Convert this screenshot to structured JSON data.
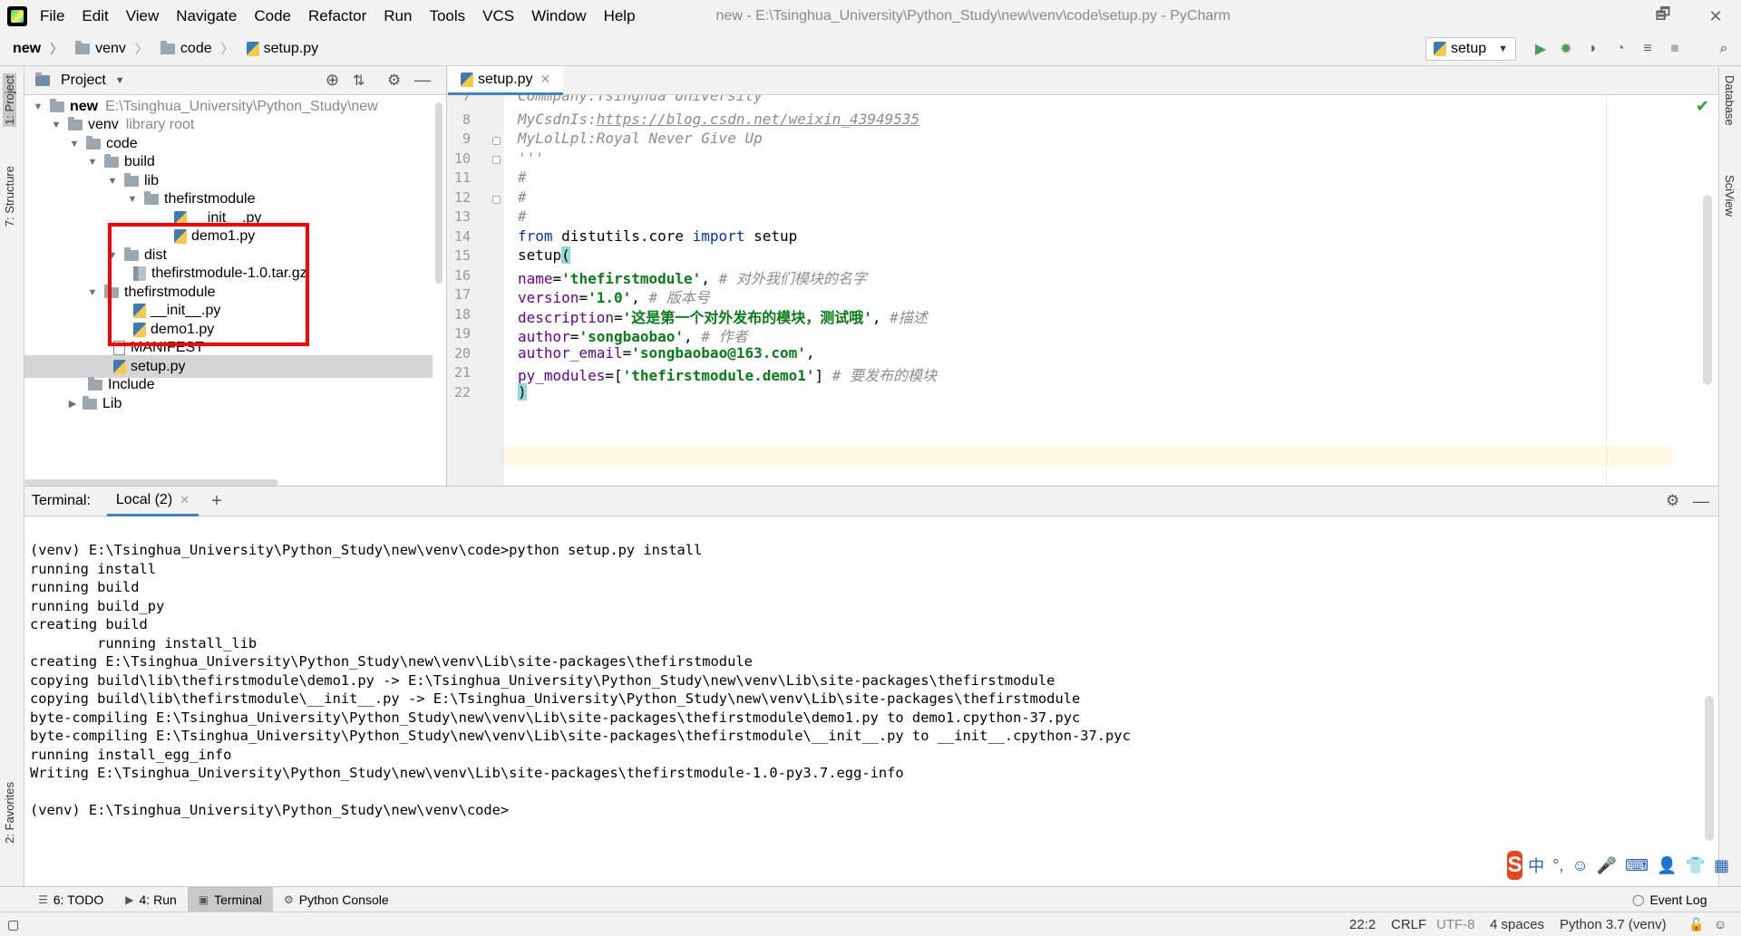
{
  "window": {
    "title": "new - E:\\Tsinghua_University\\Python_Study\\new\\venv\\code\\setup.py - PyCharm",
    "minimize": "🗕",
    "restore": "🗗",
    "close": "✕"
  },
  "menu": [
    "File",
    "Edit",
    "View",
    "Navigate",
    "Code",
    "Refactor",
    "Run",
    "Tools",
    "VCS",
    "Window",
    "Help"
  ],
  "breadcrumb": [
    "new",
    "venv",
    "code",
    "setup.py"
  ],
  "run_config": {
    "label": "setup"
  },
  "left_strip": {
    "project": "1: Project",
    "structure": "7: Structure",
    "favorites": "2: Favorites"
  },
  "right_strip": {
    "database": "Database",
    "sciview": "SciView"
  },
  "project_panel": {
    "title": "Project",
    "tree": [
      {
        "label": "new",
        "hint": "E:\\Tsinghua_University\\Python_Study\\new",
        "bold": true
      },
      {
        "label": "venv",
        "hint": "library root"
      },
      {
        "label": "code"
      },
      {
        "label": "build"
      },
      {
        "label": "lib"
      },
      {
        "label": "thefirstmodule"
      },
      {
        "label": "__init__.py"
      },
      {
        "label": "demo1.py"
      },
      {
        "label": "dist"
      },
      {
        "label": "thefirstmodule-1.0.tar.gz"
      },
      {
        "label": "thefirstmodule"
      },
      {
        "label": "__init__.py"
      },
      {
        "label": "demo1.py"
      },
      {
        "label": "MANIFEST"
      },
      {
        "label": "setup.py",
        "selected": true
      },
      {
        "label": "Include"
      },
      {
        "label": "Lib"
      }
    ]
  },
  "editor": {
    "tab": "setup.py",
    "line_numbers": [
      "7",
      "8",
      "9",
      "10",
      "11",
      "12",
      "13",
      "14",
      "15",
      "16",
      "17",
      "18",
      "19",
      "20",
      "21",
      "22"
    ],
    "code": {
      "l7": "Commpany:Tsinghua University",
      "l8_prefix": "MyCsdnIs:",
      "l8_link": "https://blog.csdn.net/weixin_43949535",
      "l9": "MyLolLpl:Royal Never Give Up",
      "l10": "'''",
      "l11": "#",
      "l12": "#",
      "l13": "#",
      "l14_from": "from",
      "l14_mod": " distutils.core ",
      "l14_import": "import",
      "l14_name": " setup",
      "l15_call": "setup",
      "l15_paren": "(",
      "l16_param": "name",
      "l16_eq": "=",
      "l16_val": "'thefirstmodule'",
      "l16_sep": ", ",
      "l16_cmt": "# 对外我们模块的名字",
      "l17_param": "version",
      "l17_eq": "=",
      "l17_val": "'1.0'",
      "l17_sep": ", ",
      "l17_cmt": "# 版本号",
      "l18_param": "description",
      "l18_eq": "=",
      "l18_val": "'这是第一个对外发布的模块，测试哦'",
      "l18_sep": ", ",
      "l18_cmt": "#描述",
      "l19_param": "author",
      "l19_eq": "=",
      "l19_val": "'songbaobao'",
      "l19_sep": ", ",
      "l19_cmt": "# 作者",
      "l20_param": "author_email",
      "l20_eq": "=",
      "l20_val": "'songbaobao@163.com'",
      "l20_sep": ",",
      "l21_param": "py_modules",
      "l21_eq": "=[",
      "l21_val": "'thefirstmodule.demo1'",
      "l21_close": "] ",
      "l21_cmt": "# 要发布的模块",
      "l22": ")"
    }
  },
  "terminal": {
    "label": "Terminal:",
    "tab": "Local (2)",
    "add": "+",
    "lines": [
      "(venv) E:\\Tsinghua_University\\Python_Study\\new\\venv\\code>python setup.py install",
      "running install",
      "running build",
      "running build_py",
      "creating build",
      "        running install_lib",
      "creating E:\\Tsinghua_University\\Python_Study\\new\\venv\\Lib\\site-packages\\thefirstmodule",
      "copying build\\lib\\thefirstmodule\\demo1.py -> E:\\Tsinghua_University\\Python_Study\\new\\venv\\Lib\\site-packages\\thefirstmodule",
      "copying build\\lib\\thefirstmodule\\__init__.py -> E:\\Tsinghua_University\\Python_Study\\new\\venv\\Lib\\site-packages\\thefirstmodule",
      "byte-compiling E:\\Tsinghua_University\\Python_Study\\new\\venv\\Lib\\site-packages\\thefirstmodule\\demo1.py to demo1.cpython-37.pyc",
      "byte-compiling E:\\Tsinghua_University\\Python_Study\\new\\venv\\Lib\\site-packages\\thefirstmodule\\__init__.py to __init__.cpython-37.pyc",
      "running install_egg_info",
      "Writing E:\\Tsinghua_University\\Python_Study\\new\\venv\\Lib\\site-packages\\thefirstmodule-1.0-py3.7.egg-info",
      "",
      "(venv) E:\\Tsinghua_University\\Python_Study\\new\\venv\\code>"
    ]
  },
  "ime": {
    "logo": "S",
    "items": [
      "中",
      "°,",
      "☺",
      "🎤",
      "⌨",
      "👤",
      "👕",
      "▦"
    ]
  },
  "bottom_tabs": [
    {
      "label": "6: TODO",
      "icon": "☰"
    },
    {
      "label": "4: Run",
      "icon": "▶"
    },
    {
      "label": "Terminal",
      "icon": "▣"
    },
    {
      "label": "Python Console",
      "icon": "⚙"
    }
  ],
  "event_log": "Event Log",
  "status": {
    "position": "22:2",
    "line_sep": "CRLF",
    "encoding": "UTF-8",
    "indent": "4 spaces",
    "interpreter": "Python 3.7 (venv)"
  }
}
